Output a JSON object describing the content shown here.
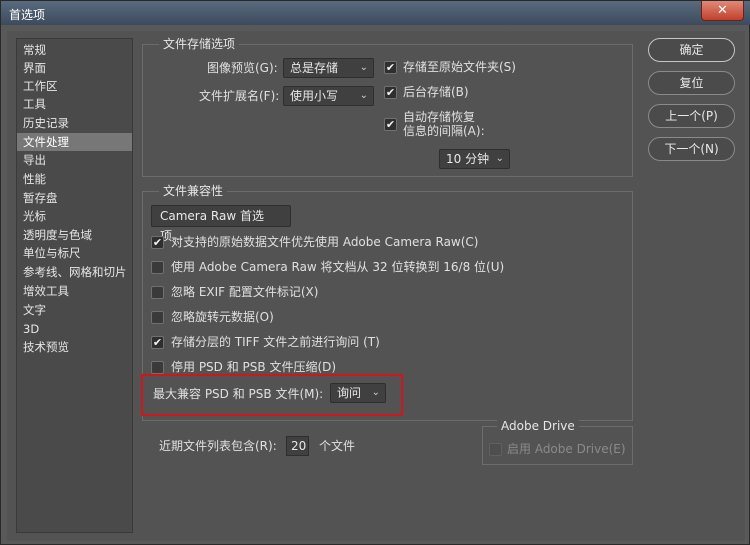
{
  "window": {
    "title": "首选项",
    "close_label": "✕"
  },
  "sidebar": {
    "items": [
      {
        "label": "常规"
      },
      {
        "label": "界面"
      },
      {
        "label": "工作区"
      },
      {
        "label": "工具"
      },
      {
        "label": "历史记录"
      },
      {
        "label": "文件处理"
      },
      {
        "label": "导出"
      },
      {
        "label": "性能"
      },
      {
        "label": "暂存盘"
      },
      {
        "label": "光标"
      },
      {
        "label": "透明度与色域"
      },
      {
        "label": "单位与标尺"
      },
      {
        "label": "参考线、网格和切片"
      },
      {
        "label": "增效工具"
      },
      {
        "label": "文字"
      },
      {
        "label": "3D"
      },
      {
        "label": "技术预览"
      }
    ],
    "selected": "文件处理"
  },
  "file_saving": {
    "title": "文件存储选项",
    "preview_label": "图像预览(G):",
    "preview_value": "总是存储",
    "extension_label": "文件扩展名(F):",
    "extension_value": "使用小写",
    "save_to_original": "存储至原始文件夹(S)",
    "background_save": "后台存储(B)",
    "autosave_line1": "自动存储恢复",
    "autosave_line2": "信息的间隔(A):",
    "interval_value": "10 分钟"
  },
  "compatibility": {
    "title": "文件兼容性",
    "camera_raw_button": "Camera Raw 首选项...",
    "options": [
      {
        "label": "对支持的原始数据文件优先使用 Adobe Camera Raw(C)",
        "checked": true
      },
      {
        "label": "使用 Adobe Camera Raw 将文档从 32 位转换到 16/8 位(U)",
        "checked": false
      },
      {
        "label": "忽略 EXIF 配置文件标记(X)",
        "checked": false
      },
      {
        "label": "忽略旋转元数据(O)",
        "checked": false
      },
      {
        "label": "存储分层的 TIFF 文件之前进行询问 (T)",
        "checked": true
      },
      {
        "label": "停用 PSD 和 PSB 文件压缩(D)",
        "checked": false
      }
    ],
    "max_compat_label": "最大兼容 PSD 和 PSB 文件(M):",
    "max_compat_value": "询问"
  },
  "recent": {
    "label": "近期文件列表包含(R):",
    "value": "20",
    "suffix": "个文件"
  },
  "adobe_drive": {
    "title": "Adobe Drive",
    "enable_label": "启用 Adobe Drive(E)",
    "checked": false
  },
  "buttons": {
    "ok": "确定",
    "reset": "复位",
    "prev": "上一个(P)",
    "next": "下一个(N)"
  },
  "icons": {
    "check": "✔",
    "chevron": "⌄"
  },
  "colors": {
    "highlight": "#d0161b",
    "panel": "#535353"
  }
}
